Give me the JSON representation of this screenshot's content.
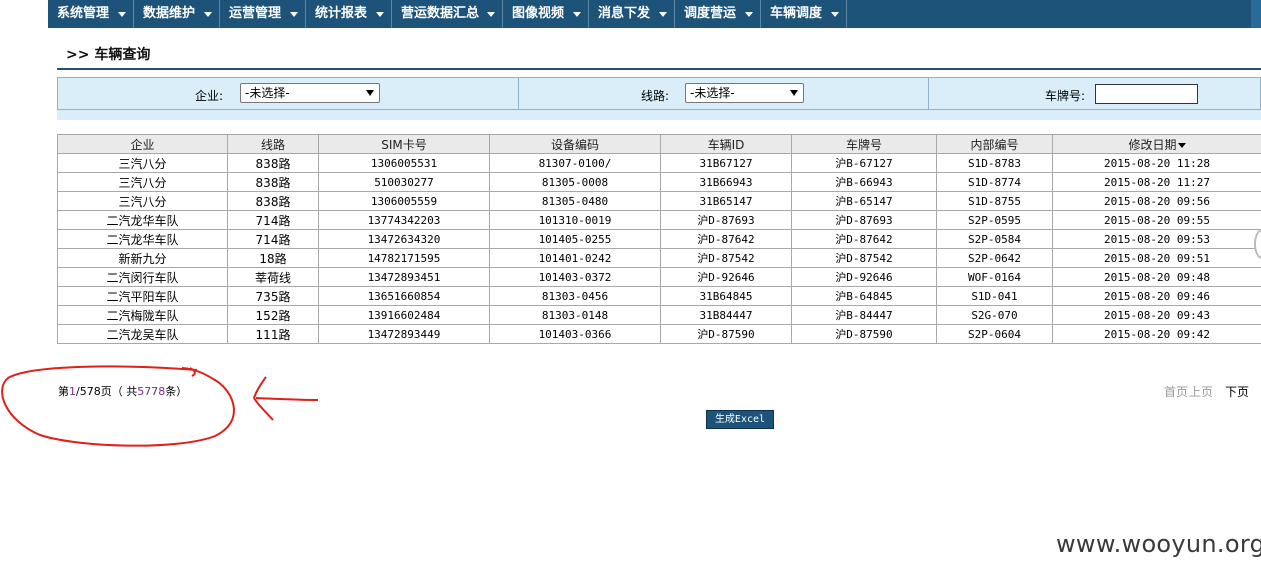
{
  "nav": {
    "items": [
      "系统管理",
      "数据维护",
      "运营管理",
      "统计报表",
      "营运数据汇总",
      "图像视频",
      "消息下发",
      "调度营运",
      "车辆调度"
    ]
  },
  "page": {
    "title": ">> 车辆查询"
  },
  "filters": {
    "company_label": "企业:",
    "company_value": "-未选择-",
    "route_label": "线路:",
    "route_value": "-未选择-",
    "plate_label": "车牌号:",
    "plate_value": ""
  },
  "table": {
    "headers": [
      "企业",
      "线路",
      "SIM卡号",
      "设备编码",
      "车辆ID",
      "车牌号",
      "内部编号",
      "修改日期"
    ],
    "rows": [
      [
        "三汽八分",
        "838路",
        "1306005531",
        "81307-0100/",
        "31B67127",
        "沪B-67127",
        "S1D-8783",
        "2015-08-20 11:28"
      ],
      [
        "三汽八分",
        "838路",
        "510030277",
        "81305-0008",
        "31B66943",
        "沪B-66943",
        "S1D-8774",
        "2015-08-20 11:27"
      ],
      [
        "三汽八分",
        "838路",
        "1306005559",
        "81305-0480",
        "31B65147",
        "沪B-65147",
        "S1D-8755",
        "2015-08-20 09:56"
      ],
      [
        "二汽龙华车队",
        "714路",
        "13774342203",
        "101310-0019",
        "沪D-87693",
        "沪D-87693",
        "S2P-0595",
        "2015-08-20 09:55"
      ],
      [
        "二汽龙华车队",
        "714路",
        "13472634320",
        "101405-0255",
        "沪D-87642",
        "沪D-87642",
        "S2P-0584",
        "2015-08-20 09:53"
      ],
      [
        "新新九分",
        "18路",
        "14782171595",
        "101401-0242",
        "沪D-87542",
        "沪D-87542",
        "S2P-0642",
        "2015-08-20 09:51"
      ],
      [
        "二汽闵行车队",
        "莘荷线",
        "13472893451",
        "101403-0372",
        "沪D-92646",
        "沪D-92646",
        "WOF-0164",
        "2015-08-20 09:48"
      ],
      [
        "二汽平阳车队",
        "735路",
        "13651660854",
        "81303-0456",
        "31B64845",
        "沪B-64845",
        "S1D-041",
        "2015-08-20 09:46"
      ],
      [
        "二汽梅陇车队",
        "152路",
        "13916602484",
        "81303-0148",
        "31B84447",
        "沪B-84447",
        "S2G-070",
        "2015-08-20 09:43"
      ],
      [
        "二汽龙吴车队",
        "111路",
        "13472893449",
        "101403-0366",
        "沪D-87590",
        "沪D-87590",
        "S2P-0604",
        "2015-08-20 09:42"
      ]
    ]
  },
  "pagination": {
    "prefix": "第",
    "current": "1",
    "middle": "/578页（ 共",
    "total": "5778",
    "suffix": "条）",
    "first": "首页",
    "prev": "上页",
    "next": "下页"
  },
  "actions": {
    "export": "生成Excel"
  },
  "watermark": "www.wooyun.org",
  "colors": {
    "nav_bg": "#1d5279",
    "filter_bg": "#d9eef9",
    "annotation": "#e0201a"
  }
}
